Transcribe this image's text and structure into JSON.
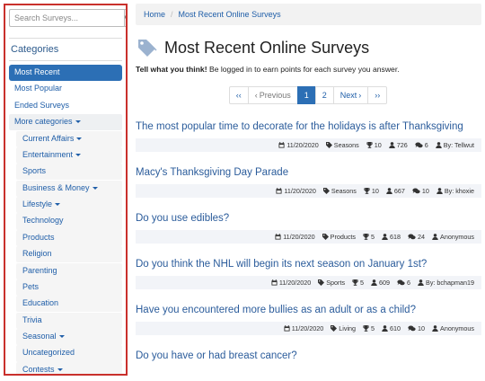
{
  "search": {
    "placeholder": "Search Surveys..."
  },
  "sidebar": {
    "categories_title": "Categories",
    "items": [
      {
        "label": "Most Recent",
        "type": "active"
      },
      {
        "label": "Most Popular",
        "type": "top"
      },
      {
        "label": "Ended Surveys",
        "type": "top"
      },
      {
        "label": "More categories",
        "type": "more"
      },
      {
        "label": "Current Affairs",
        "type": "sub",
        "dropdown": true
      },
      {
        "label": "Entertainment",
        "type": "sub",
        "dropdown": true
      },
      {
        "label": "Sports",
        "type": "sub"
      },
      {
        "label": "Business & Money",
        "type": "sub",
        "dropdown": true
      },
      {
        "label": "Lifestyle",
        "type": "sub",
        "dropdown": true
      },
      {
        "label": "Technology",
        "type": "sub"
      },
      {
        "label": "Products",
        "type": "sub"
      },
      {
        "label": "Religion",
        "type": "sub"
      },
      {
        "label": "Parenting",
        "type": "sub"
      },
      {
        "label": "Pets",
        "type": "sub"
      },
      {
        "label": "Education",
        "type": "sub"
      },
      {
        "label": "Trivia",
        "type": "sub"
      },
      {
        "label": "Seasonal",
        "type": "sub",
        "dropdown": true
      },
      {
        "label": "Uncategorized",
        "type": "sub"
      },
      {
        "label": "Contests",
        "type": "sub",
        "dropdown": true
      }
    ]
  },
  "breadcrumb": {
    "home": "Home",
    "current": "Most Recent Online Surveys"
  },
  "page": {
    "title": "Most Recent Online Surveys",
    "tagline_bold": "Tell what you think!",
    "tagline_rest": " Be logged in to earn points for each survey you answer."
  },
  "pager": {
    "first": "‹‹",
    "prev": "Previous",
    "pages": [
      "1",
      "2"
    ],
    "current_page": "1",
    "next": "Next",
    "last": "››"
  },
  "surveys": [
    {
      "title": "The most popular time to decorate for the holidays is after Thanksgiving",
      "date": "11/20/2020",
      "category": "Seasons",
      "points": "10",
      "responses": "726",
      "comments": "6",
      "author": "By: Tellwut"
    },
    {
      "title": "Macy's Thanksgiving Day Parade",
      "date": "11/20/2020",
      "category": "Seasons",
      "points": "10",
      "responses": "667",
      "comments": "10",
      "author": "By: khoxie"
    },
    {
      "title": "Do you use edibles?",
      "date": "11/20/2020",
      "category": "Products",
      "points": "5",
      "responses": "618",
      "comments": "24",
      "author": "Anonymous"
    },
    {
      "title": "Do you think the NHL will begin its next season on January 1st?",
      "date": "11/20/2020",
      "category": "Sports",
      "points": "5",
      "responses": "609",
      "comments": "6",
      "author": "By: bchapman19"
    },
    {
      "title": "Have you encountered more bullies as an adult or as a child?",
      "date": "11/20/2020",
      "category": "Living",
      "points": "5",
      "responses": "610",
      "comments": "10",
      "author": "Anonymous"
    },
    {
      "title": "Do you have or had breast cancer?"
    }
  ],
  "colors": {
    "accent": "#2c6fb5",
    "highlight_border": "#c9302c",
    "link": "#1f5ea8"
  }
}
